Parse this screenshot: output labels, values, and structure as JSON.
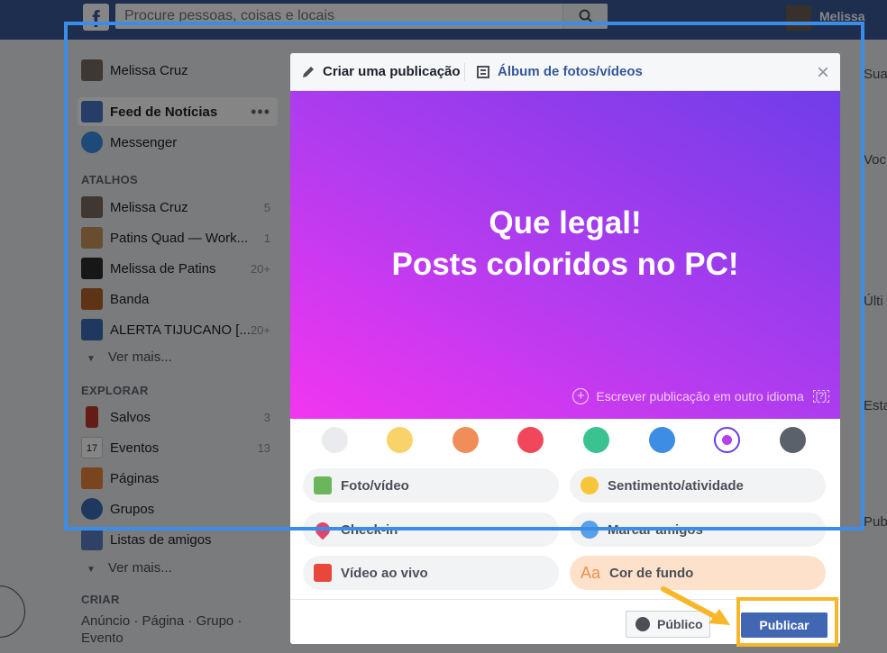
{
  "topbar": {
    "logo": "f",
    "search_placeholder": "Procure pessoas, coisas e locais",
    "user_name": "Melissa"
  },
  "sidebar": {
    "profile": "Melissa Cruz",
    "feed": "Feed de Notícias",
    "feed_more": "•••",
    "messenger": "Messenger",
    "shortcuts_header": "ATALHOS",
    "shortcuts": [
      {
        "label": "Melissa Cruz",
        "count": "5"
      },
      {
        "label": "Patins Quad — Work...",
        "count": "1"
      },
      {
        "label": "Melissa de Patins",
        "count": "20+"
      },
      {
        "label": "Banda",
        "count": ""
      },
      {
        "label": "ALERTA TIJUCANO [...",
        "count": "20+"
      }
    ],
    "see_more_1": "Ver mais...",
    "explore_header": "EXPLORAR",
    "explore": [
      {
        "label": "Salvos",
        "count": "3"
      },
      {
        "label": "Eventos",
        "count": "13"
      },
      {
        "label": "Páginas",
        "count": ""
      },
      {
        "label": "Grupos",
        "count": ""
      },
      {
        "label": "Listas de amigos",
        "count": ""
      }
    ],
    "calendar_day": "17",
    "see_more_2": "Ver mais...",
    "create_header": "CRIAR",
    "create_links": "Anúncio · Página · Grupo · Evento"
  },
  "right_col": [
    "Sua",
    "Voc",
    "Últi",
    "Esta",
    "Pub"
  ],
  "modal": {
    "tab_create": "Criar uma publicação",
    "tab_album": "Álbum de fotos/vídeos",
    "close": "×",
    "post_line1": "Que legal!",
    "post_line2": "Posts coloridos no PC!",
    "lang_link": "Escrever publicação em outro idioma",
    "lang_help": "[?]",
    "swatches": [
      "#e9ebee",
      "#f7d369",
      "#f08e5a",
      "#f0475a",
      "#3ac391",
      "#3d8de5",
      "#ffffff",
      "#5a616b"
    ],
    "selected_swatch": 6,
    "options": {
      "photo": "Foto/vídeo",
      "feeling": "Sentimento/atividade",
      "checkin": "Check-in",
      "tag": "Marcar amigos",
      "live": "Vídeo ao vivo",
      "background": "Cor de fundo",
      "background_icon": "Aa"
    },
    "privacy": "Público",
    "publish": "Publicar"
  },
  "colors": {
    "brand": "#3b5998",
    "annotation_frame": "#3b8ee8",
    "annotation_highlight": "#f7b728",
    "publish": "#4267b2"
  }
}
